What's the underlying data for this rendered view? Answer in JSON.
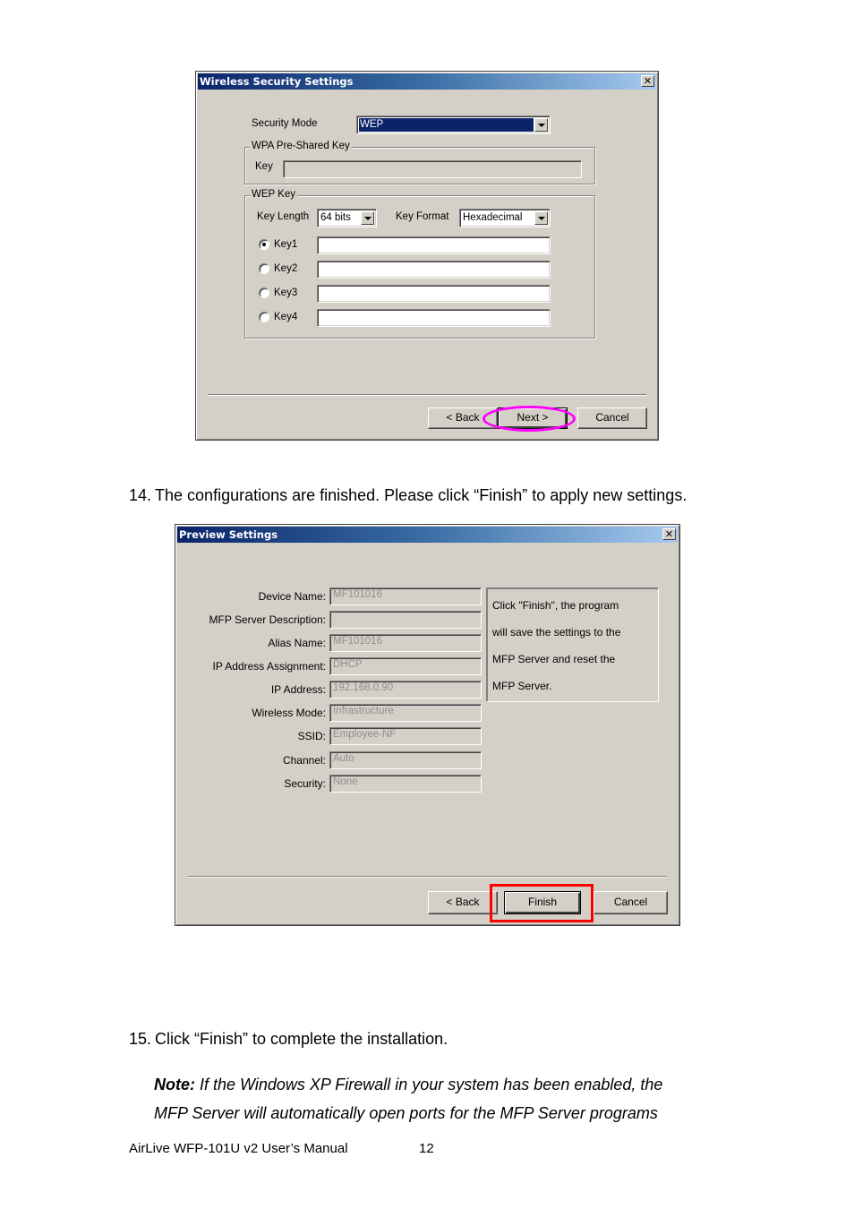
{
  "dialog1": {
    "title": "Wireless Security Settings",
    "close_glyph": "✕",
    "security_mode_label": "Security Mode",
    "security_mode_value": "WEP",
    "wpa_group_title": "WPA Pre-Shared Key",
    "wpa_key_label": "Key",
    "wpa_key_value": "",
    "wep_group_title": "WEP Key",
    "key_length_label": "Key Length",
    "key_length_value": "64 bits",
    "key_format_label": "Key Format",
    "key_format_value": "Hexadecimal",
    "keys": [
      {
        "label": "Key1",
        "selected": true,
        "value": ""
      },
      {
        "label": "Key2",
        "selected": false,
        "value": ""
      },
      {
        "label": "Key3",
        "selected": false,
        "value": ""
      },
      {
        "label": "Key4",
        "selected": false,
        "value": ""
      }
    ],
    "back_label": "< Back",
    "next_label": "Next >",
    "cancel_label": "Cancel",
    "highlight_color": "#ff00ff"
  },
  "step14": {
    "number": "14.",
    "text": "The configurations are finished. Please click “Finish” to apply new settings."
  },
  "dialog2": {
    "title": "Preview Settings",
    "close_glyph": "✕",
    "fields": [
      {
        "label": "Device Name:",
        "value": "MF101016"
      },
      {
        "label": "MFP Server Description:",
        "value": ""
      },
      {
        "label": "Alias Name:",
        "value": "MF101016"
      },
      {
        "label": "IP Address Assignment:",
        "value": "DHCP"
      },
      {
        "label": "IP Address:",
        "value": "192.168.0.90"
      },
      {
        "label": "Wireless Mode:",
        "value": "Infrastructure"
      },
      {
        "label": "SSID:",
        "value": "Employee-NF"
      },
      {
        "label": "Channel:",
        "value": "Auto"
      },
      {
        "label": "Security:",
        "value": "None"
      }
    ],
    "info_lines": [
      "Click \"Finish\", the program",
      "will save the settings to the",
      "MFP Server and reset the",
      "MFP Server."
    ],
    "back_label": "< Back",
    "finish_label": "Finish",
    "cancel_label": "Cancel",
    "highlight_color": "#ff0000"
  },
  "step15": {
    "number": "15.",
    "text": "Click “Finish” to complete the installation."
  },
  "note": {
    "label": "Note:",
    "line1": " If the Windows XP Firewall in your system has been enabled, the",
    "line2": "MFP Server will automatically open ports for the MFP Server programs"
  },
  "footer": {
    "manual_title": "AirLive WFP-101U v2 User’s Manual",
    "page_number": "12"
  }
}
